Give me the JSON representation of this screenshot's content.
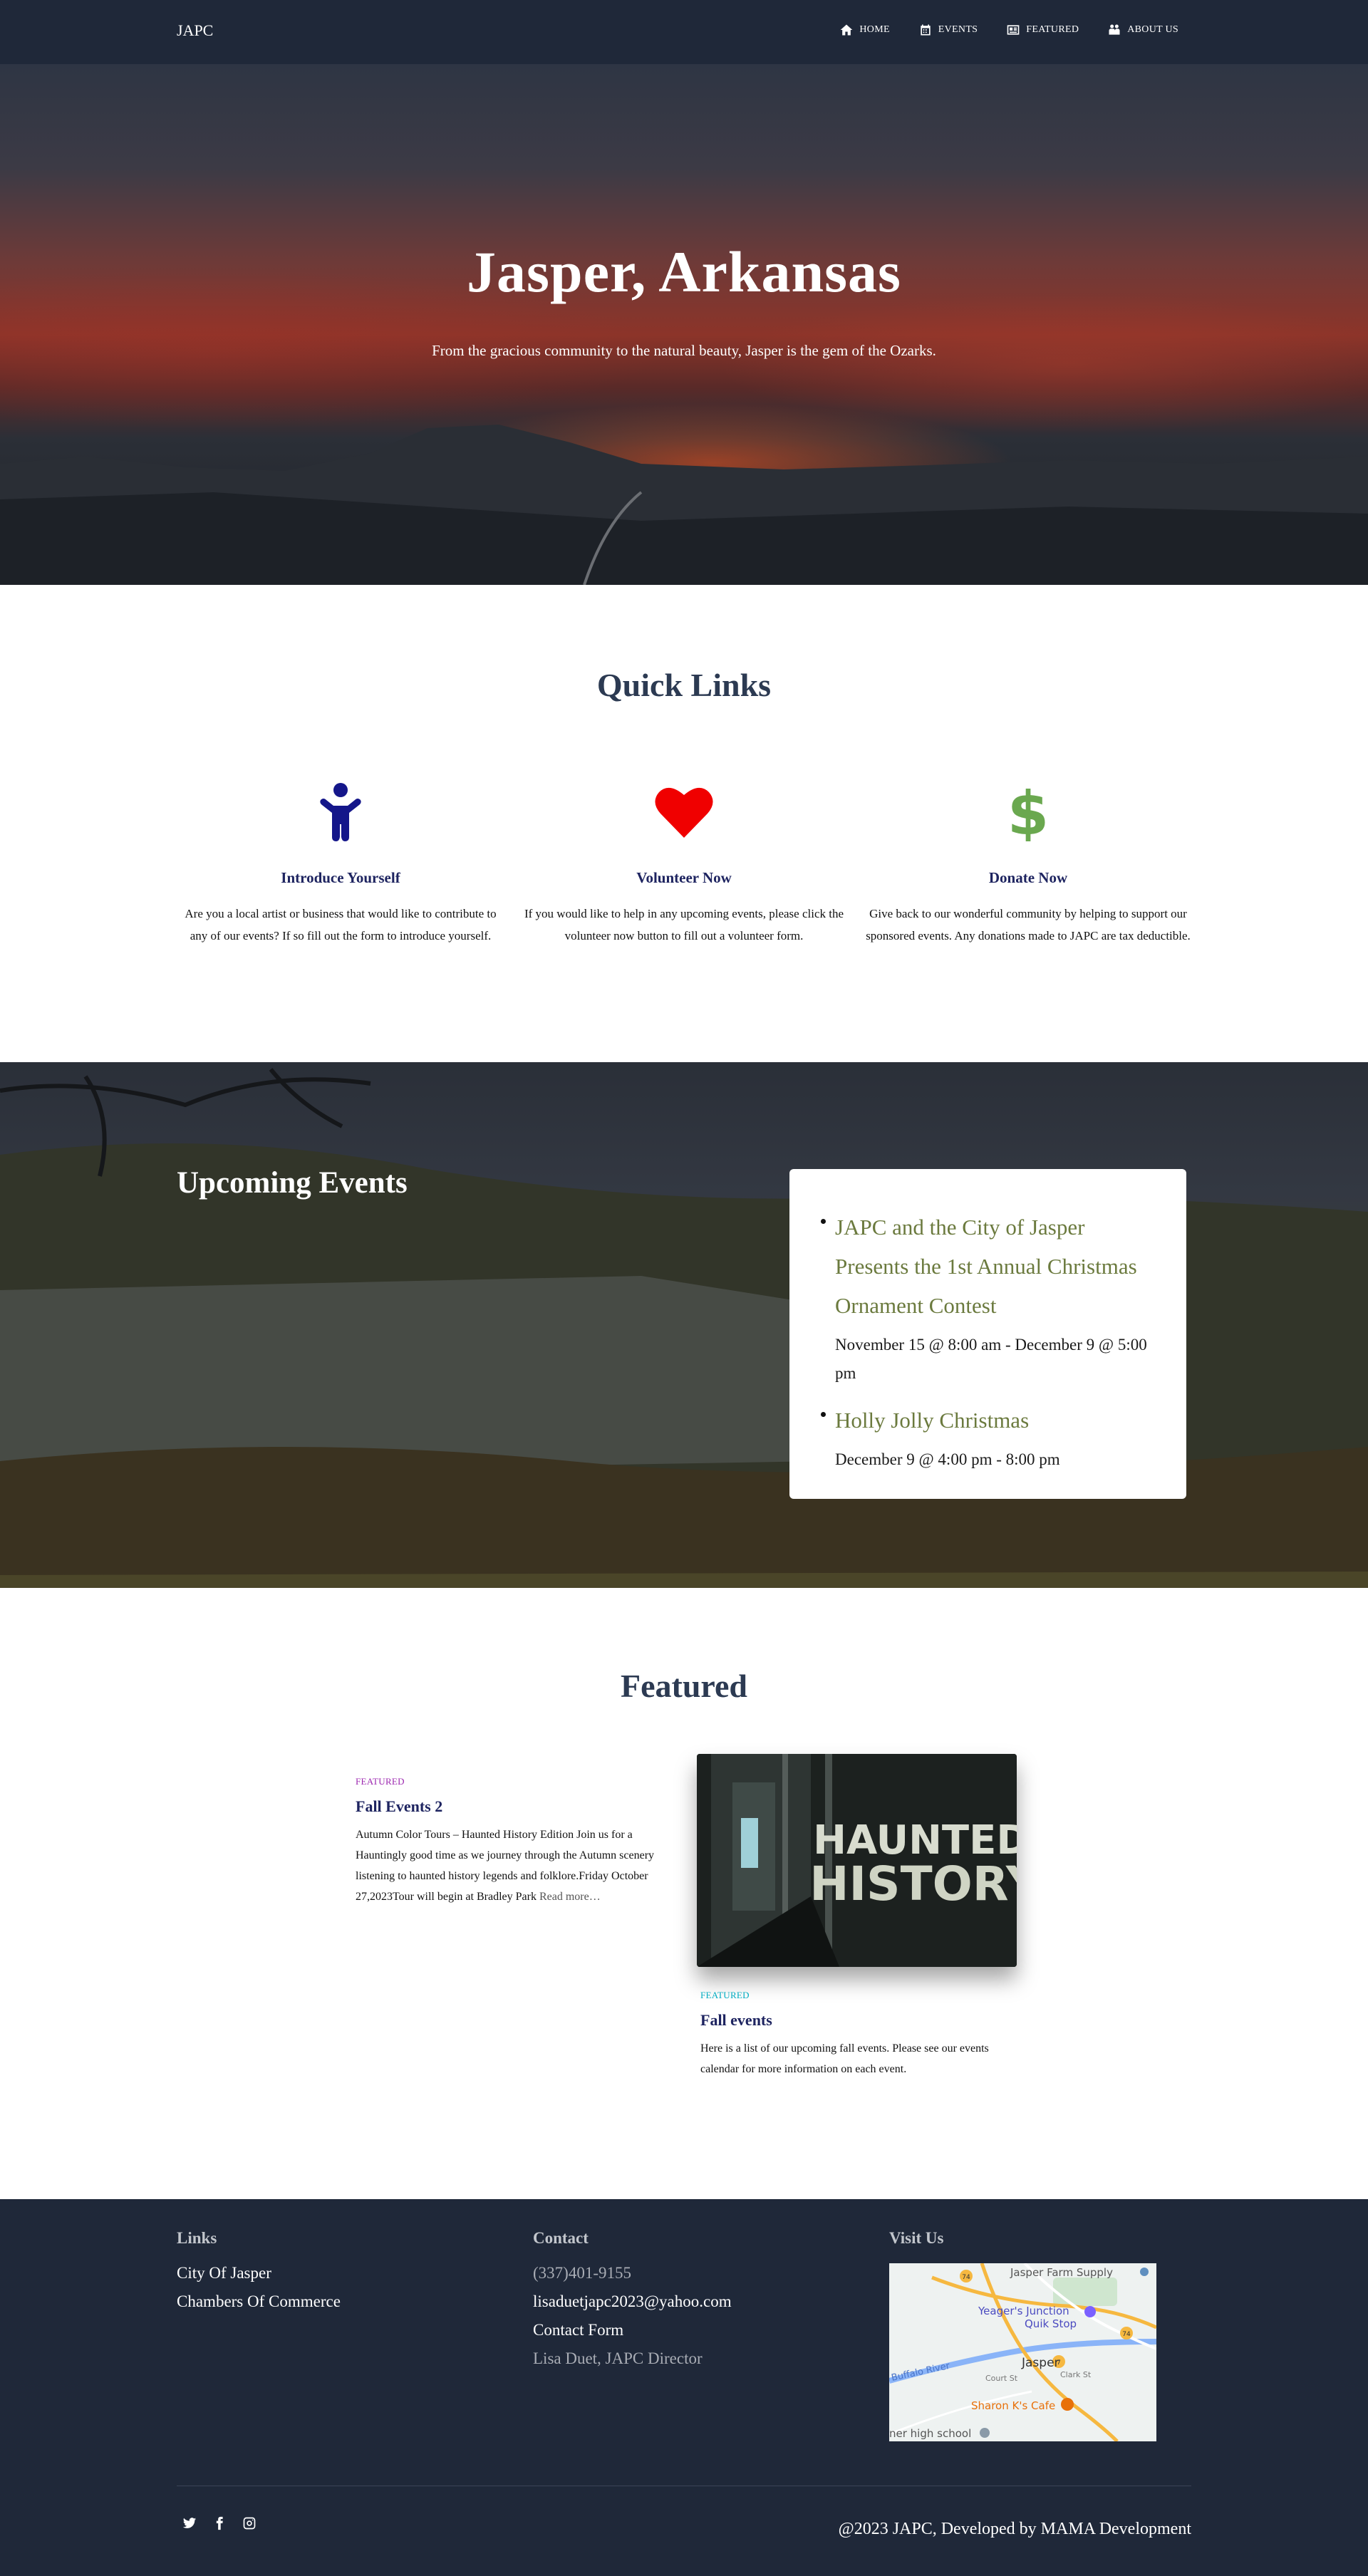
{
  "navbar": {
    "brand": "JAPC",
    "items": [
      {
        "label": "HOME",
        "icon": "home-icon"
      },
      {
        "label": "EVENTS",
        "icon": "calendar-icon"
      },
      {
        "label": "FEATURED",
        "icon": "newspaper-icon"
      },
      {
        "label": "ABOUT US",
        "icon": "people-icon"
      }
    ]
  },
  "hero": {
    "title": "Jasper, Arkansas",
    "subtitle": "From the gracious community to the natural beauty, Jasper is the gem of the Ozarks."
  },
  "quick_links": {
    "title": "Quick Links",
    "items": [
      {
        "icon": "person-icon",
        "color": "#14168a",
        "heading": "Introduce Yourself",
        "text": "Are you a local artist or business that would like to contribute to any of our events? If so fill out the form to introduce yourself."
      },
      {
        "icon": "heart-icon",
        "color": "#f00000",
        "heading": "Volunteer Now",
        "text": "If you would like to help in any upcoming events, please click the volunteer now button to fill out a volunteer form."
      },
      {
        "icon": "dollar-icon",
        "color": "#6aa84f",
        "heading": "Donate Now",
        "text": "Give back to our wonderful community by helping to support our sponsored events. Any donations made to JAPC are tax deductible."
      }
    ]
  },
  "events": {
    "title": "Upcoming Events",
    "items": [
      {
        "title": "JAPC and the City of Jasper Presents the 1st Annual Christmas Ornament Contest",
        "date": "November 15 @ 8:00 am - December 9 @ 5:00 pm"
      },
      {
        "title": "Holly Jolly Christmas",
        "date": "December 9 @ 4:00 pm - 8:00 pm"
      }
    ]
  },
  "featured": {
    "title": "Featured",
    "posts": [
      {
        "tag": "FEATURED",
        "tag_color": "#9c27b0",
        "title": "Fall Events 2",
        "excerpt": "Autumn Color Tours – Haunted History Edition Join us for a Hauntingly good time as we journey through the Autumn scenery listening to haunted history legends and folklore.Friday October 27,2023Tour will begin at Bradley Park",
        "more": "Read more…"
      },
      {
        "tag": "FEATURED",
        "tag_color": "#00acc1",
        "title": "Fall events",
        "excerpt": "Here is a list of our upcoming fall events. Please see our events calendar for more information on each event.",
        "image_text_1": "HAUNTED",
        "image_text_2": "HISTORY"
      }
    ]
  },
  "footer": {
    "links": {
      "heading": "Links",
      "items": [
        "City Of Jasper",
        "Chambers Of Commerce"
      ]
    },
    "contact": {
      "heading": "Contact",
      "items": [
        "(337)401-9155",
        "lisaduetjapc2023@yahoo.com",
        "Contact Form",
        "Lisa Duet, JAPC Director"
      ]
    },
    "visit": {
      "heading": "Visit Us",
      "map_labels": {
        "farm": "Jasper Farm Supply",
        "junction": "Yeager's Junction",
        "quik": "Quik Stop",
        "town": "Jasper",
        "river": "Buffalo River",
        "court": "Court St",
        "clark": "Clark St",
        "cafe": "Sharon K's Cafe",
        "school": "ner high school",
        "route_a": "74",
        "route_b": "74",
        "route_c": "7"
      }
    },
    "social": [
      "twitter-icon",
      "facebook-icon",
      "instagram-icon"
    ],
    "copyright": "@2023 JAPC, Developed by MAMA Development"
  }
}
